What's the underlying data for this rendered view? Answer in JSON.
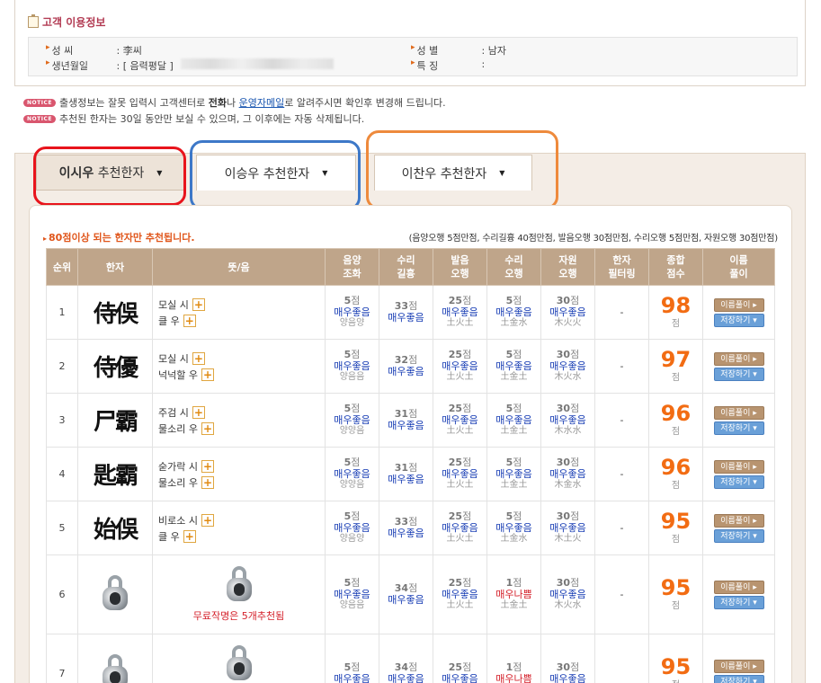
{
  "info": {
    "title": "고객 이용정보",
    "name_label": "성      씨",
    "name_value": ": 李씨",
    "birth_label": "생년월일",
    "birth_value": ": [ 음력평달 ]",
    "gender_label": "성      별",
    "gender_value": ": 남자",
    "feature_label": "특      징",
    "feature_value": ":"
  },
  "notices": {
    "badge": "NOTICE",
    "n1_pre": "출생정보는 잘못 입력시 고객센터로",
    "n1_bold": "전화",
    "n1_mid": "나",
    "n1_link": "운영자메일",
    "n1_post": "로 알려주시면 확인후 변경해 드립니다.",
    "n2": "추천된 한자는 30일 동안만 보실 수 있으며, 그 이후에는 자동 삭제됩니다."
  },
  "tabs": [
    {
      "name": "이시우",
      "suffix": "추천한자"
    },
    {
      "name": "이승우",
      "suffix": "추천한자"
    },
    {
      "name": "이찬우",
      "suffix": "추천한자"
    }
  ],
  "warning": "80점이상 되는 한자만 추천됩니다.",
  "score_note": "(음양오행 5점만점, 수리길흉 40점만점, 발음오행 30점만점, 수리오행 5점만점, 자원오행 30점만점)",
  "headers": {
    "rank": "순위",
    "hanja": "한자",
    "meaning": "뜻/음",
    "yinyang_1": "음양",
    "yinyang_2": "조화",
    "suri_1": "수리",
    "suri_2": "길흉",
    "pron_1": "발음",
    "pron_2": "오행",
    "suri5_1": "수리",
    "suri5_2": "오행",
    "jawon_1": "자원",
    "jawon_2": "오행",
    "filter_1": "한자",
    "filter_2": "필터링",
    "total_1": "종합",
    "total_2": "점수",
    "namefx_1": "이름",
    "namefx_2": "풀이"
  },
  "jeom": "점",
  "btn_interpret": "이름풀이 ▸",
  "btn_save": "저장하기 ▾",
  "free_text": "무료작명은 5개추천됨",
  "rows": [
    {
      "rank": "1",
      "hanja": "侍俁",
      "m1": "모실 시",
      "m2": "클 우",
      "yy": "5",
      "yy_l": "매우좋음",
      "yy_s": "양음양",
      "sr": "33",
      "sr_l": "매우좋음",
      "po": "25",
      "po_l": "매우좋음",
      "po_s": "土火土",
      "so": "5",
      "so_l": "매우좋음",
      "so_s": "土金水",
      "jw": "30",
      "jw_l": "매우좋음",
      "jw_s": "木火火",
      "filter": "-",
      "total": "98"
    },
    {
      "rank": "2",
      "hanja": "侍優",
      "m1": "모실 시",
      "m2": "넉넉할 우",
      "yy": "5",
      "yy_l": "매우좋음",
      "yy_s": "양음음",
      "sr": "32",
      "sr_l": "매우좋음",
      "po": "25",
      "po_l": "매우좋음",
      "po_s": "土火土",
      "so": "5",
      "so_l": "매우좋음",
      "so_s": "土金土",
      "jw": "30",
      "jw_l": "매우좋음",
      "jw_s": "木火水",
      "filter": "-",
      "total": "97"
    },
    {
      "rank": "3",
      "hanja": "尸霸",
      "m1": "주검 시",
      "m2": "물소리 우",
      "yy": "5",
      "yy_l": "매우좋음",
      "yy_s": "양양음",
      "sr": "31",
      "sr_l": "매우좋음",
      "po": "25",
      "po_l": "매우좋음",
      "po_s": "土火土",
      "so": "5",
      "so_l": "매우좋음",
      "so_s": "土金土",
      "jw": "30",
      "jw_l": "매우좋음",
      "jw_s": "木水水",
      "filter": "-",
      "total": "96"
    },
    {
      "rank": "4",
      "hanja": "匙霸",
      "m1": "숟가락 시",
      "m2": "물소리 우",
      "yy": "5",
      "yy_l": "매우좋음",
      "yy_s": "양양음",
      "sr": "31",
      "sr_l": "매우좋음",
      "po": "25",
      "po_l": "매우좋음",
      "po_s": "土火土",
      "so": "5",
      "so_l": "매우좋음",
      "so_s": "土金土",
      "jw": "30",
      "jw_l": "매우좋음",
      "jw_s": "木金水",
      "filter": "-",
      "total": "96"
    },
    {
      "rank": "5",
      "hanja": "始俁",
      "m1": "비로소 시",
      "m2": "클 우",
      "yy": "5",
      "yy_l": "매우좋음",
      "yy_s": "양음양",
      "sr": "33",
      "sr_l": "매우좋음",
      "po": "25",
      "po_l": "매우좋음",
      "po_s": "土火土",
      "so": "5",
      "so_l": "매우좋음",
      "so_s": "土金水",
      "jw": "30",
      "jw_l": "매우좋음",
      "jw_s": "木土火",
      "filter": "-",
      "total": "95"
    },
    {
      "rank": "6",
      "yy": "5",
      "yy_l": "매우좋음",
      "yy_s": "양음음",
      "sr": "34",
      "sr_l": "매우좋음",
      "po": "25",
      "po_l": "매우좋음",
      "po_s": "土火土",
      "so": "1",
      "so_l": "매우나쁨",
      "so_s": "土金土",
      "jw": "30",
      "jw_l": "매우좋음",
      "jw_s": "木火水",
      "filter": "-",
      "total": "95"
    },
    {
      "rank": "7",
      "yy": "5",
      "yy_l": "매우좋음",
      "sr": "34",
      "sr_l": "매우좋음",
      "po": "25",
      "po_l": "매우좋음",
      "so": "1",
      "so_l": "매우나쁨",
      "jw": "30",
      "jw_l": "매우좋음",
      "total": "95"
    }
  ]
}
